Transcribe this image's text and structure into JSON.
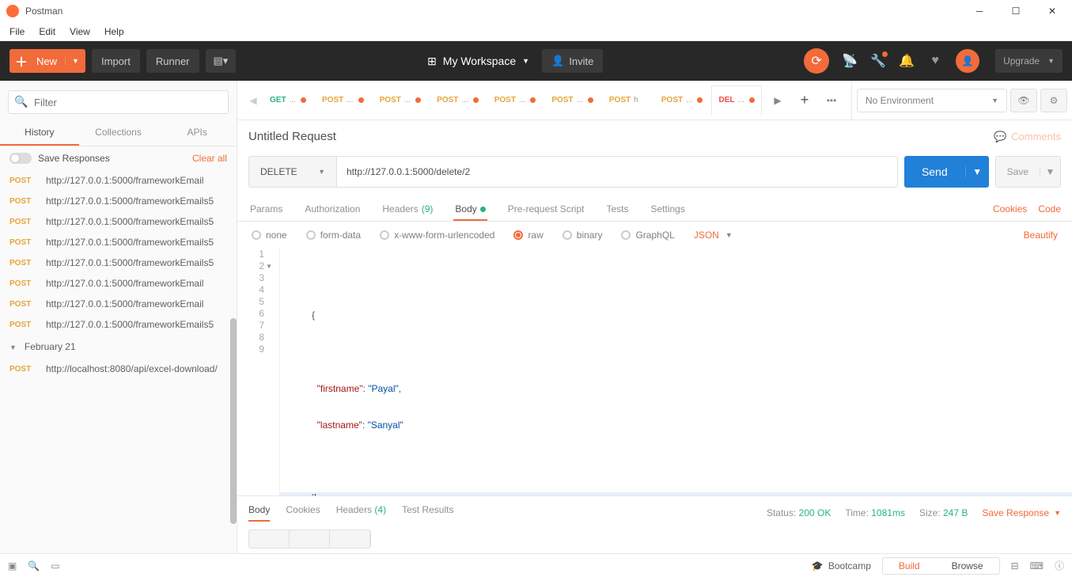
{
  "window": {
    "title": "Postman"
  },
  "menubar": [
    "File",
    "Edit",
    "View",
    "Help"
  ],
  "header": {
    "new": "New",
    "import": "Import",
    "runner": "Runner",
    "workspace": "My Workspace",
    "invite": "Invite",
    "upgrade": "Upgrade"
  },
  "sidebar": {
    "filter_placeholder": "Filter",
    "tabs": [
      "History",
      "Collections",
      "APIs"
    ],
    "active_tab": 0,
    "save_responses": "Save Responses",
    "clear_all": "Clear all",
    "history": [
      {
        "method": "POST",
        "url": "http://127.0.0.1:5000/frameworkEmail"
      },
      {
        "method": "POST",
        "url": "http://127.0.0.1:5000/frameworkEmails5"
      },
      {
        "method": "POST",
        "url": "http://127.0.0.1:5000/frameworkEmails5"
      },
      {
        "method": "POST",
        "url": "http://127.0.0.1:5000/frameworkEmails5"
      },
      {
        "method": "POST",
        "url": "http://127.0.0.1:5000/frameworkEmails5"
      },
      {
        "method": "POST",
        "url": "http://127.0.0.1:5000/frameworkEmail"
      },
      {
        "method": "POST",
        "url": "http://127.0.0.1:5000/frameworkEmail"
      },
      {
        "method": "POST",
        "url": "http://127.0.0.1:5000/frameworkEmails5"
      }
    ],
    "date_group": "February 21",
    "history2": [
      {
        "method": "POST",
        "url": "http://localhost:8080/api/excel-download/"
      }
    ]
  },
  "tabs": [
    {
      "method": "GET",
      "label": "...",
      "dirty": true
    },
    {
      "method": "POST",
      "label": "...",
      "dirty": true
    },
    {
      "method": "POST",
      "label": "...",
      "dirty": true
    },
    {
      "method": "POST",
      "label": "...",
      "dirty": true
    },
    {
      "method": "POST",
      "label": "...",
      "dirty": true
    },
    {
      "method": "POST",
      "label": "...",
      "dirty": true
    },
    {
      "method": "POST",
      "label": "h",
      "dirty": false
    },
    {
      "method": "POST",
      "label": "...",
      "dirty": true
    },
    {
      "method": "DEL",
      "label": "...",
      "dirty": true,
      "active": true
    }
  ],
  "env": {
    "label": "No Environment"
  },
  "request": {
    "title": "Untitled Request",
    "comments": "Comments",
    "method": "DELETE",
    "url": "http://127.0.0.1:5000/delete/2",
    "send": "Send",
    "save": "Save",
    "tabs": {
      "params": "Params",
      "auth": "Authorization",
      "headers": "Headers",
      "headers_count": "(9)",
      "body": "Body",
      "prereq": "Pre-request Script",
      "tests": "Tests",
      "settings": "Settings",
      "cookies": "Cookies",
      "code": "Code"
    },
    "body_opts": {
      "none": "none",
      "formdata": "form-data",
      "xwww": "x-www-form-urlencoded",
      "raw": "raw",
      "binary": "binary",
      "graphql": "GraphQL",
      "json": "JSON",
      "beautify": "Beautify"
    },
    "editor_lines": [
      "",
      "{",
      "",
      "  \"firstname\": \"Payal\",",
      "  \"lastname\": \"Sanyal\"",
      "",
      "}",
      "",
      ""
    ]
  },
  "response": {
    "tabs": {
      "body": "Body",
      "cookies": "Cookies",
      "headers": "Headers",
      "headers_count": "(4)",
      "tests": "Test Results"
    },
    "status_label": "Status:",
    "status_value": "200 OK",
    "time_label": "Time:",
    "time_value": "1081ms",
    "size_label": "Size:",
    "size_value": "247 B",
    "save": "Save Response"
  },
  "statusbar": {
    "bootcamp": "Bootcamp",
    "build": "Build",
    "browse": "Browse"
  }
}
